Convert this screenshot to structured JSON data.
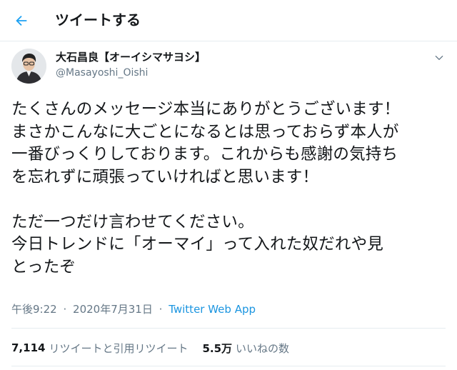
{
  "header": {
    "title": "ツイートする"
  },
  "author": {
    "name": "大石昌良【オーイシマサヨシ】",
    "handle": "@Masayoshi_Oishi"
  },
  "tweet": {
    "lines": [
      "たくさんのメッセージ本当にありがとうございます！",
      "まさかこんなに大ごとになるとは思っておらず本人が",
      "一番びっくりしております。これからも感謝の気持ち",
      "を忘れずに頑張っていければと思います！",
      "",
      "ただ一つだけ言わせてください。",
      "今日トレンドに「オーマイ」って入れた奴だれや見",
      "とったぞ"
    ]
  },
  "meta": {
    "time": "午後9:22",
    "date": "2020年7月31日",
    "separator": "·",
    "source": "Twitter Web App"
  },
  "stats": {
    "retweets_count": "7,114",
    "retweets_label": "リツイートと引用リツイート",
    "likes_count": "5.5万",
    "likes_label": "いいねの数"
  },
  "colors": {
    "accent": "#1b95e0",
    "secondary_text": "#657786",
    "divider": "#e6ecf0"
  },
  "icons": {
    "back": "arrow-left-icon",
    "more": "chevron-down-icon"
  }
}
